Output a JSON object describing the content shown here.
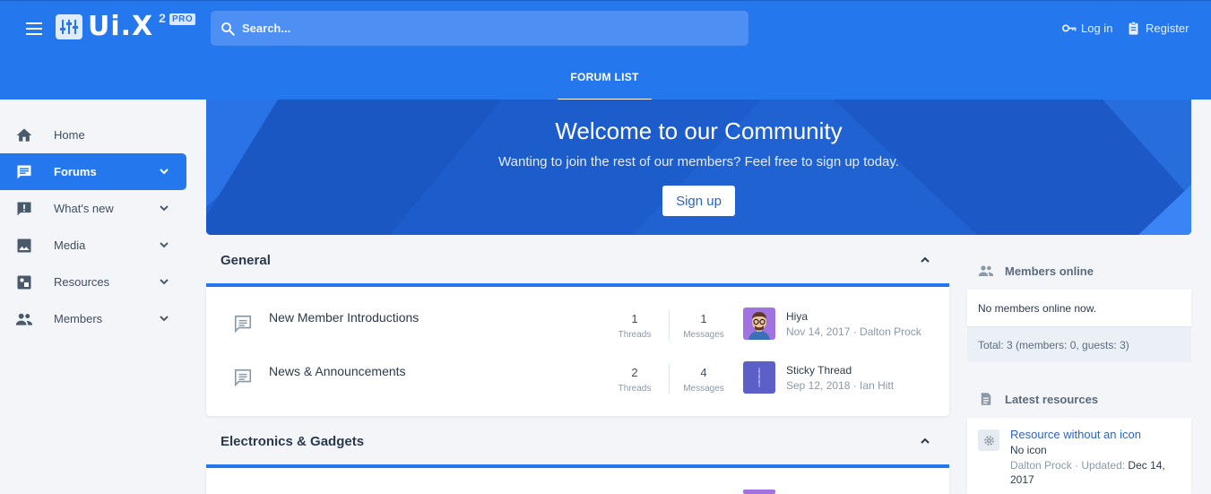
{
  "header": {
    "logo_text": "Ui.X",
    "logo_version": "2",
    "logo_badge": "PRO",
    "search_placeholder": "Search...",
    "login_label": "Log in",
    "register_label": "Register",
    "nav_tab": "FORUM LIST",
    "accent": "#2577ee"
  },
  "sidebar": {
    "items": [
      {
        "label": "Home",
        "icon": "home-icon"
      },
      {
        "label": "Forums",
        "icon": "forum-icon",
        "active": true
      },
      {
        "label": "What's new",
        "icon": "alert-message-icon"
      },
      {
        "label": "Media",
        "icon": "image-icon"
      },
      {
        "label": "Resources",
        "icon": "resource-icon"
      },
      {
        "label": "Members",
        "icon": "people-icon"
      }
    ]
  },
  "hero": {
    "title": "Welcome to our Community",
    "subtitle": "Wanting to join the rest of our members? Feel free to sign up today.",
    "button": "Sign up"
  },
  "categories": [
    {
      "title": "General",
      "forums": [
        {
          "title": "New Member Introductions",
          "threads": "1",
          "messages": "1",
          "latest_title": "Hiya",
          "latest_meta": "Nov 14, 2017 · Dalton Prock"
        },
        {
          "title": "News & Announcements",
          "threads": "2",
          "messages": "4",
          "latest_title": "Sticky Thread",
          "latest_meta": "Sep 12, 2018 · Ian Hitt"
        }
      ]
    },
    {
      "title": "Electronics & Gadgets",
      "forums": []
    }
  ],
  "labels": {
    "threads": "Threads",
    "messages": "Messages"
  },
  "widgets": {
    "members_online": {
      "title": "Members online",
      "body": "No members online now.",
      "footer": "Total: 3 (members: 0, guests: 3)"
    },
    "latest_resources": {
      "title": "Latest resources",
      "item_title": "Resource without an icon",
      "item_sub": "No icon",
      "item_author": "Dalton Prock",
      "item_sep": " · Updated: ",
      "item_date": "Dec 14, 2017"
    }
  }
}
